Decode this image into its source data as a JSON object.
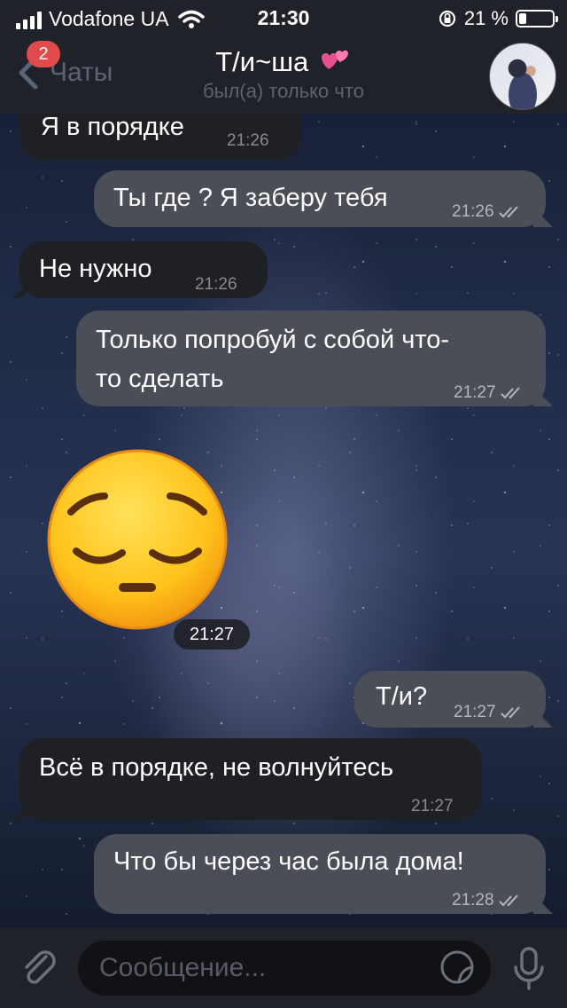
{
  "status_bar": {
    "carrier": "Vodafone UA",
    "time": "21:30",
    "battery_percent": "21 %",
    "battery_level": 0.21
  },
  "header": {
    "back_label": "Чаты",
    "unread_badge": "2",
    "title": "Т/и~ша",
    "title_emoji_icon": "two-hearts-icon",
    "subtitle": "был(а) только что"
  },
  "messages": [
    {
      "direction": "in",
      "text": "Я в порядке",
      "time": "21:26"
    },
    {
      "direction": "out",
      "text": "Ты где ? Я заберу тебя",
      "time": "21:26",
      "read": true
    },
    {
      "direction": "in",
      "text": "Не нужно",
      "time": "21:26"
    },
    {
      "direction": "out",
      "text_line1": "Только попробуй с собой что-",
      "text_line2": "то сделать",
      "time": "21:27",
      "read": true
    },
    {
      "direction": "in",
      "type": "sticker",
      "sticker_icon": "pensive-face-icon",
      "time": "21:27"
    },
    {
      "direction": "out",
      "text": "Т/и?",
      "time": "21:27",
      "read": true
    },
    {
      "direction": "in",
      "text": "Всё в порядке, не волнуйтесь",
      "time": "21:27"
    },
    {
      "direction": "out",
      "text": "Что бы через час была дома!",
      "time": "21:28",
      "read": true
    }
  ],
  "input_bar": {
    "placeholder": "Сообщение...",
    "attach_icon": "paperclip-icon",
    "sticker_icon": "sticker-icon",
    "mic_icon": "microphone-icon"
  },
  "colors": {
    "incoming_bubble": "#1f2023",
    "outgoing_bubble": "#4a4e57",
    "badge": "#e24b4b",
    "bars": "#1f2229"
  }
}
